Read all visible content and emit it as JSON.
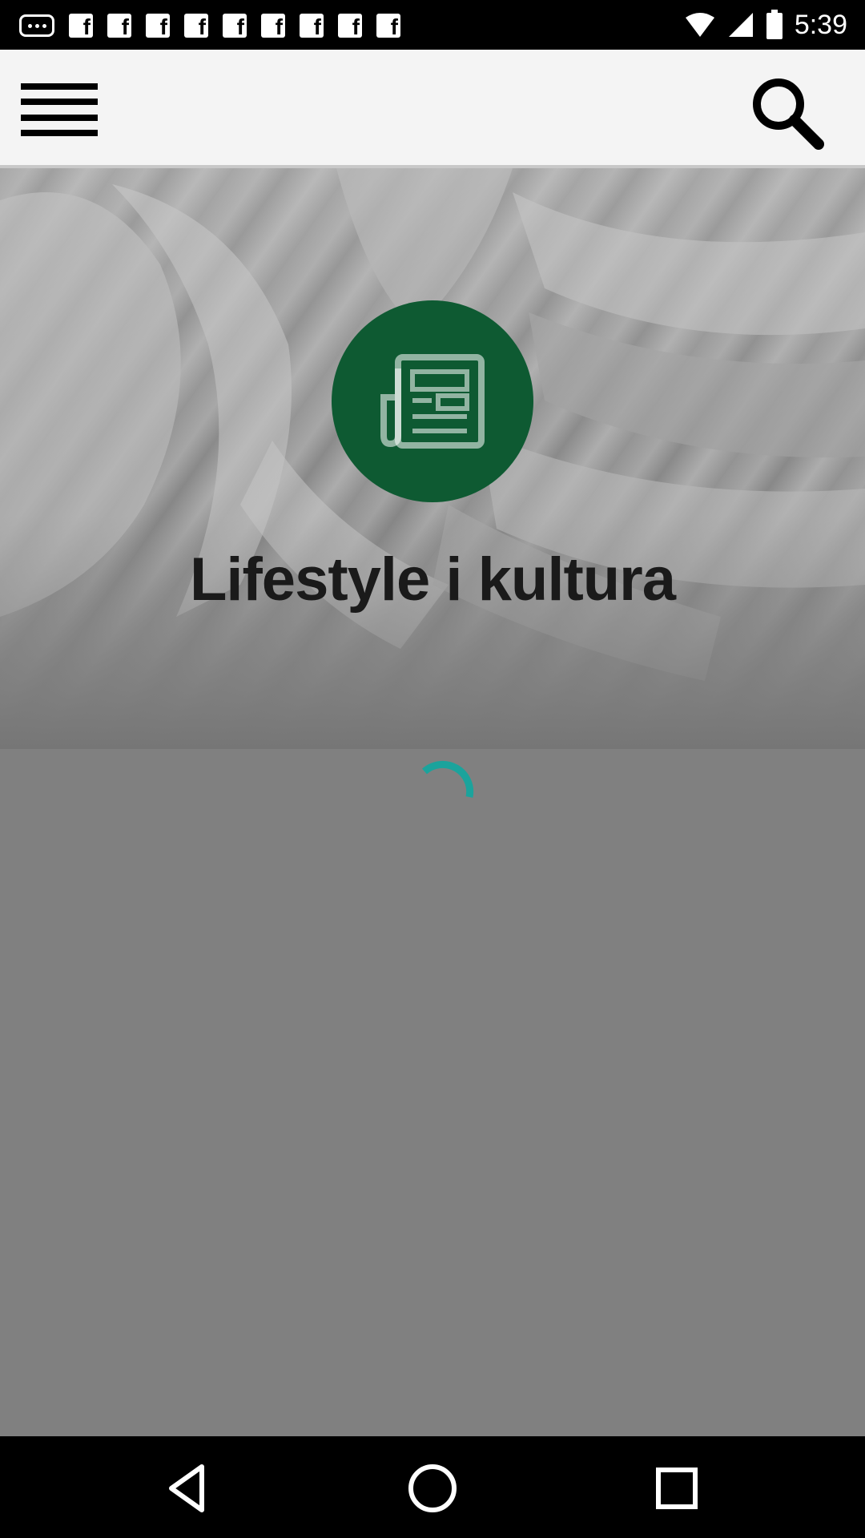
{
  "status_bar": {
    "time": "5:39",
    "icons": [
      "notification-dots-icon",
      "facebook-icon",
      "wifi-icon",
      "signal-icon",
      "battery-icon"
    ]
  },
  "app_bar": {
    "menu_icon": "menu-icon",
    "search_icon": "search-icon"
  },
  "hero": {
    "badge_icon": "newspaper-icon",
    "badge_color": "#0e5a32",
    "title": "Lifestyle i kultura"
  },
  "loading": {
    "icon": "loading-spinner-icon",
    "color": "#1ba39c"
  },
  "nav_bar": {
    "back_icon": "back-icon",
    "home_icon": "home-icon",
    "recents_icon": "recents-icon"
  }
}
